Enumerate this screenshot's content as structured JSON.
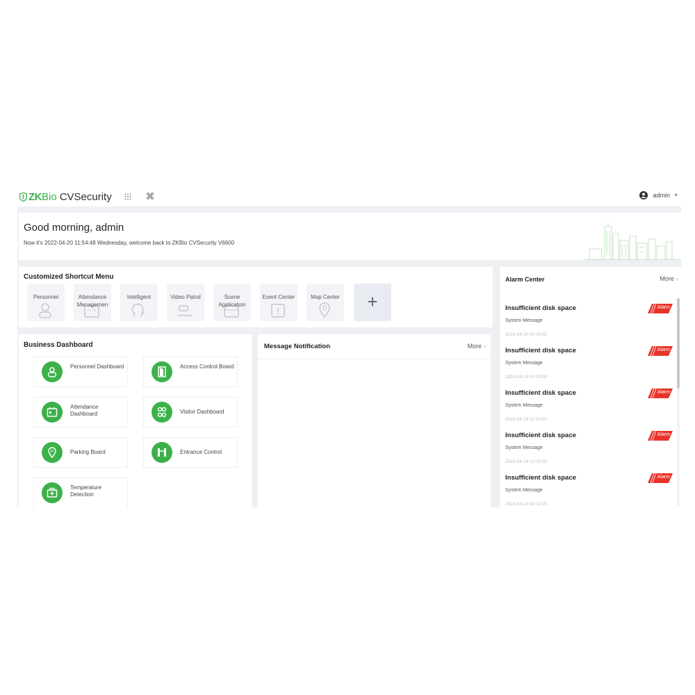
{
  "app": {
    "brand_zk": "ZK",
    "brand_bio": "Bio",
    "brand_name": "CVSecurity"
  },
  "topbar": {
    "icons": [
      "grid-icon",
      "command-icon"
    ],
    "user": "admin"
  },
  "welcome": {
    "greeting": "Good morning, admin",
    "subtitle": "Now it's 2022-04-20 11:54:48 Wednesday, welcome back to ZKBio CVSecurity V6600"
  },
  "shortcut": {
    "title": "Customized Shortcut Menu",
    "items": [
      {
        "label": "Personnel"
      },
      {
        "label": "Attendance Managemen"
      },
      {
        "label": "Intelligent"
      },
      {
        "label": "Video Patrol"
      },
      {
        "label": "Scene Application"
      },
      {
        "label": "Event Center"
      },
      {
        "label": "Map Center"
      }
    ],
    "add_label": "+"
  },
  "business": {
    "title": "Business Dashboard",
    "items": [
      {
        "label": "Personnel Dashboard"
      },
      {
        "label": "Access Control Board"
      },
      {
        "label": "Attendance Dashboard"
      },
      {
        "label": "Visitor Dashboard"
      },
      {
        "label": "Parking Board"
      },
      {
        "label": "Entrance Control"
      },
      {
        "label": "Temperature Detection"
      }
    ]
  },
  "message": {
    "title": "Message Notification",
    "more": "More"
  },
  "alarm": {
    "title": "Alarm Center",
    "more": "More",
    "badge_color": "#e8342a",
    "items": [
      {
        "title": "Insufficient disk space",
        "type": "System Message",
        "time": "2022-04-20 00:00:02",
        "badge": "Alarm"
      },
      {
        "title": "Insufficient disk space",
        "type": "System Message",
        "time": "2022-04-19 10:00:00",
        "badge": "Alarm"
      },
      {
        "title": "Insufficient disk space",
        "type": "System Message",
        "time": "2022-04-19 11:00:00",
        "badge": "Alarm"
      },
      {
        "title": "Insufficient disk space",
        "type": "System Message",
        "time": "2022-04-19 12:00:00",
        "badge": "Alarm"
      },
      {
        "title": "Insufficient disk space",
        "type": "System Message",
        "time": "2022-04-19 00:02:25",
        "badge": "Alarm"
      }
    ]
  },
  "colors": {
    "brand_green": "#3cb14a",
    "page_bg": "#eef0f4"
  }
}
